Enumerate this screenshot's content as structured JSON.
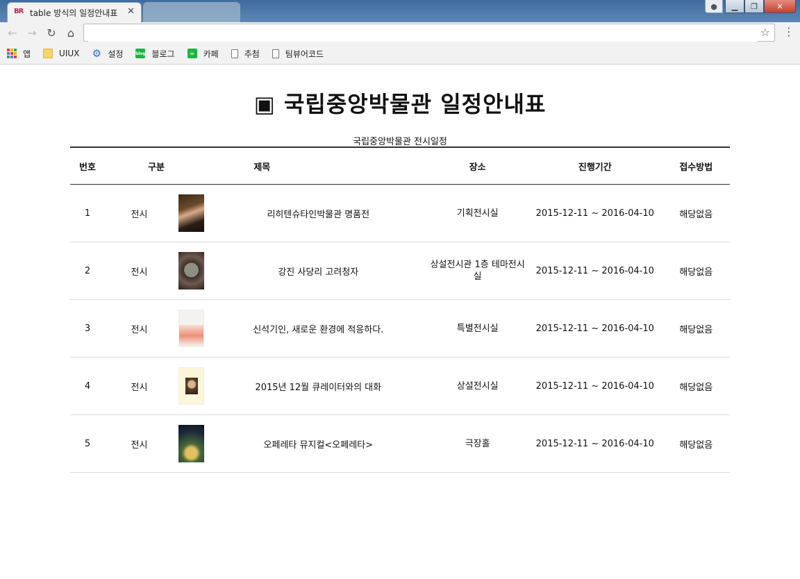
{
  "browser": {
    "active_tab_title": "table 방식의 일정안내표",
    "favicon_text": "BR",
    "address": "",
    "bookmarks": [
      {
        "label": "앱",
        "icon": "apps-grid-icon"
      },
      {
        "label": "UIUX",
        "icon": "folder-icon"
      },
      {
        "label": "설정",
        "icon": "gear-icon"
      },
      {
        "label": "블로그",
        "icon": "blog-icon"
      },
      {
        "label": "카페",
        "icon": "cafe-icon"
      },
      {
        "label": "추첨",
        "icon": "page-icon"
      },
      {
        "label": "팀뷰어코드",
        "icon": "page-icon"
      }
    ]
  },
  "page": {
    "title": "▣ 국립중앙박물관 일정안내표",
    "caption": "국립중앙박물관 전시일정",
    "columns": [
      "번호",
      "구분",
      "제목",
      "장소",
      "진행기간",
      "접수방법"
    ],
    "rows": [
      {
        "num": "1",
        "type": "전시",
        "title": "리히텐슈타인박물관 명품전",
        "place": "기획전시실",
        "period": "2015-12-11 ~ 2016-04-10",
        "apply": "해당없음"
      },
      {
        "num": "2",
        "type": "전시",
        "title": "강진 사당리 고려청자",
        "place": "상설전시관 1층 테마전시실",
        "period": "2015-12-11 ~ 2016-04-10",
        "apply": "해당없음"
      },
      {
        "num": "3",
        "type": "전시",
        "title": "신석기인, 새로운 환경에 적응하다.",
        "place": "특별전시실",
        "period": "2015-12-11 ~ 2016-04-10",
        "apply": "해당없음"
      },
      {
        "num": "4",
        "type": "전시",
        "title": "2015년 12월 큐레이터와의 대화",
        "place": "상설전시실",
        "period": "2015-12-11 ~ 2016-04-10",
        "apply": "해당없음"
      },
      {
        "num": "5",
        "type": "전시",
        "title": "오페레타 뮤지컬<오페레타>",
        "place": "극장홀",
        "period": "2015-12-11 ~ 2016-04-10",
        "apply": "해당없음"
      }
    ]
  },
  "colors": {
    "titlebar": "#4a76a8",
    "header_rule": "#333333",
    "row_rule": "#dcdcdc",
    "title_text": "#555555"
  }
}
